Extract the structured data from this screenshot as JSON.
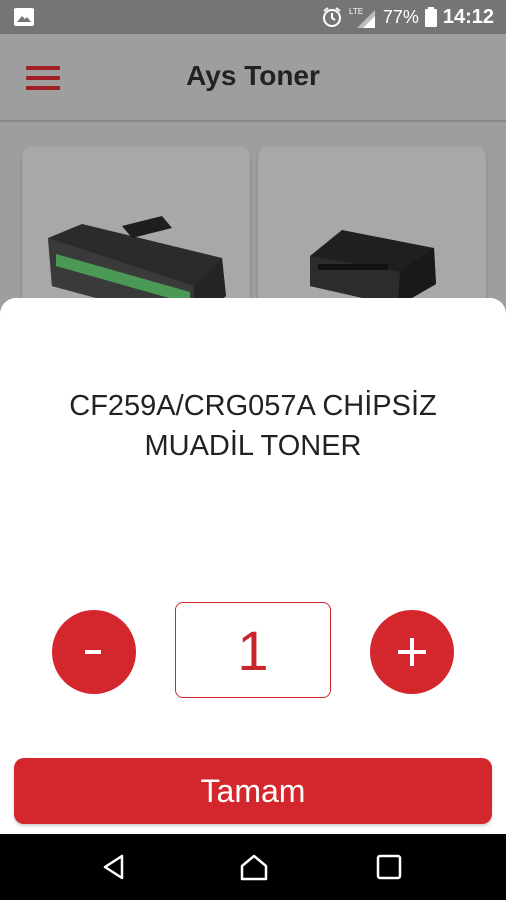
{
  "status_bar": {
    "notification_icon": "image-icon",
    "alarm_icon": "alarm-icon",
    "network_label": "LTE",
    "battery": "77%",
    "time": "14:12"
  },
  "app_bar": {
    "title": "Ays Toner",
    "menu_icon": "hamburger-menu-icon"
  },
  "products": [
    {
      "image": "toner-cartridge-image"
    },
    {
      "image": "toner-cartridge-image"
    }
  ],
  "dialog": {
    "product_name": "CF259A/CRG057A CHİPSİZ MUADİL TONER",
    "decrement_label": "-",
    "quantity": "1",
    "increment_label": "+",
    "confirm_label": "Tamam"
  },
  "nav_bar": {
    "back_icon": "back-icon",
    "home_icon": "home-icon",
    "recents_icon": "recents-icon"
  },
  "colors": {
    "accent": "#d4262d",
    "scrim": "#9e9e9e",
    "status_bar": "#757575"
  }
}
